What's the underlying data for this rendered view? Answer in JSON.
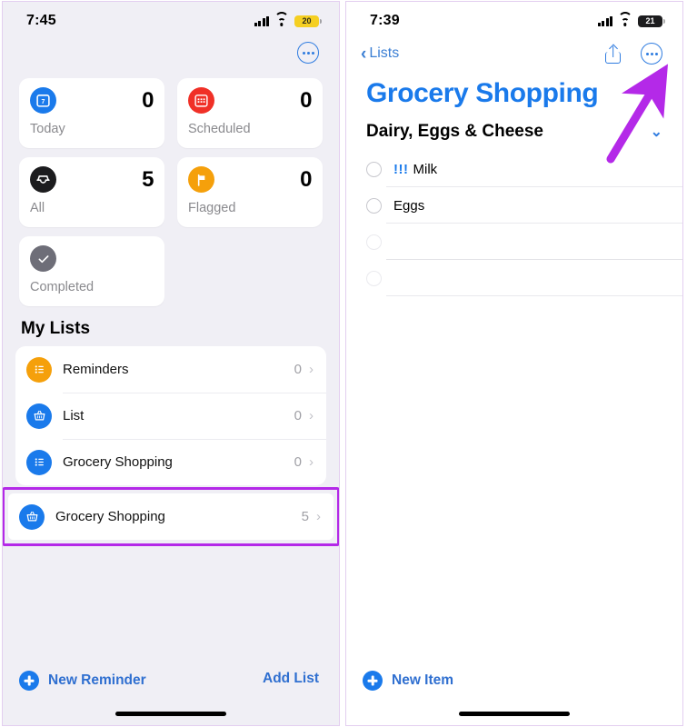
{
  "left": {
    "status": {
      "time": "7:45",
      "battery": "20",
      "battery_style": "yellow",
      "signal_icon": "cellular-icon",
      "wifi_icon": "wifi-icon"
    },
    "more_button": "more-options",
    "cards": [
      {
        "label": "Today",
        "count": "0",
        "icon": "calendar-today-icon",
        "color": "#1a7aeb"
      },
      {
        "label": "Scheduled",
        "count": "0",
        "icon": "calendar-scheduled-icon",
        "color": "#f03027"
      },
      {
        "label": "All",
        "count": "5",
        "icon": "inbox-icon",
        "color": "#1c1c1e"
      },
      {
        "label": "Flagged",
        "count": "0",
        "icon": "flag-icon",
        "color": "#f5a00b"
      },
      {
        "label": "Completed",
        "count": "",
        "icon": "checkmark-icon",
        "color": "#6e6e78"
      }
    ],
    "section_title": "My Lists",
    "lists": [
      {
        "label": "Reminders",
        "count": "0",
        "icon": "list-bullet-icon",
        "color": "#f5a00b"
      },
      {
        "label": "List",
        "count": "0",
        "icon": "basket-icon",
        "color": "#1a7aeb"
      },
      {
        "label": "Grocery Shopping",
        "count": "0",
        "icon": "list-bullet-icon",
        "color": "#1a7aeb"
      }
    ],
    "highlighted_list": {
      "label": "Grocery Shopping",
      "count": "5",
      "icon": "basket-icon",
      "color": "#1a7aeb",
      "highlight_color": "#b429e8"
    },
    "chevron": "›",
    "new_reminder_label": "New Reminder",
    "add_list_label": "Add List"
  },
  "right": {
    "status": {
      "time": "7:39",
      "battery": "21",
      "battery_style": "dark",
      "signal_icon": "cellular-icon",
      "wifi_icon": "wifi-icon"
    },
    "back_label": "Lists",
    "back_chevron": "‹",
    "share_button": "share",
    "more_button": "more-options",
    "title": "Grocery Shopping",
    "group": {
      "title": "Dairy, Eggs & Cheese",
      "chevron": "⌄"
    },
    "items": [
      {
        "priority": "!!!",
        "text": "Milk"
      },
      {
        "priority": "",
        "text": "Eggs"
      },
      {
        "priority": "",
        "text": ""
      },
      {
        "priority": "",
        "text": ""
      }
    ],
    "new_item_label": "New Item"
  },
  "annotation": {
    "arrow_color": "#b429e8",
    "target": "more-options-button"
  }
}
